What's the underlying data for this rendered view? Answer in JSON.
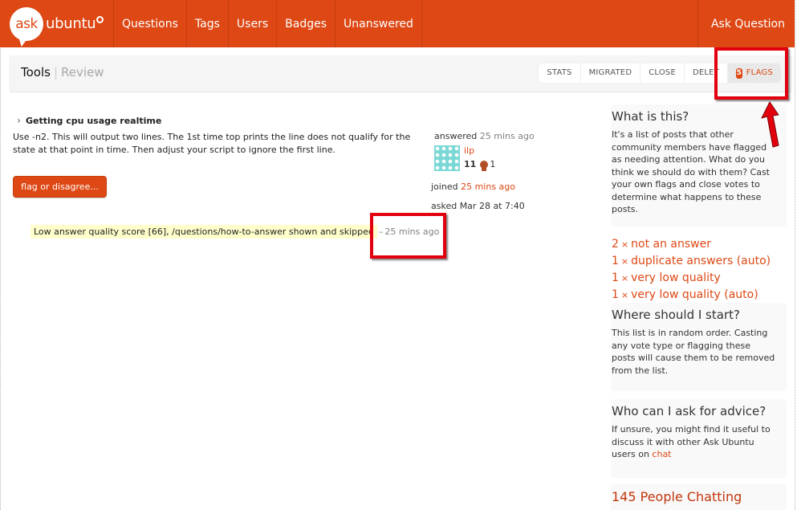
{
  "topbar": {
    "logo": {
      "ask": "ask",
      "ubuntu": "ubuntu"
    },
    "nav": [
      {
        "label": "Questions"
      },
      {
        "label": "Tags"
      },
      {
        "label": "Users"
      },
      {
        "label": "Badges"
      },
      {
        "label": "Unanswered"
      }
    ],
    "ask_question": "Ask Question",
    "brand_color": "#dd4814"
  },
  "subheader": {
    "title": "Tools",
    "separator": "|",
    "subtitle": "Review",
    "tabs": [
      {
        "label": "STATS"
      },
      {
        "label": "MIGRATED"
      },
      {
        "label": "CLOSE"
      },
      {
        "label": "DELET"
      }
    ],
    "flags_tab": {
      "count": "5",
      "label": "FLAGS",
      "active": true
    }
  },
  "post": {
    "title": "Getting cpu usage realtime",
    "body": "Use -n2. This will output two lines. The 1st time top prints the line does not qualify for the state at that point in time. Then adjust your script to ignore the first line.",
    "flag_button": "flag or disagree...",
    "answered_label": "answered",
    "answered_time": "25 mins ago",
    "user": {
      "name": "ilp",
      "reputation": "11",
      "bronze_badges": "1"
    },
    "joined_label": "joined",
    "joined_time": "25 mins ago",
    "asked": "asked Mar 28 at 7:40",
    "review_note": "Low answer quality score [66], /questions/how-to-answer shown and skipped",
    "review_dash": "–",
    "review_time": "25 mins ago"
  },
  "sidebar": {
    "what": {
      "title": "What is this?",
      "text": "It's a list of posts that other community members have flagged as needing attention. What do you think we should do with them? Cast your own flags and close votes to determine what happens to these posts."
    },
    "flag_counts": [
      {
        "count": "2",
        "label": "not an answer"
      },
      {
        "count": "1",
        "label": "duplicate answers (auto)"
      },
      {
        "count": "1",
        "label": "very low quality"
      },
      {
        "count": "1",
        "label": "very low quality (auto)"
      }
    ],
    "times_symbol": "×",
    "where": {
      "title": "Where should I start?",
      "text": "This list is in random order. Casting any vote type or flagging these posts will cause them to be removed from the list."
    },
    "who": {
      "title": "Who can I ask for advice?",
      "text_before": "If unsure, you might find it useful to discuss it with other Ask Ubuntu users on ",
      "link": "chat"
    },
    "chat": {
      "title": "145 People Chatting"
    }
  }
}
